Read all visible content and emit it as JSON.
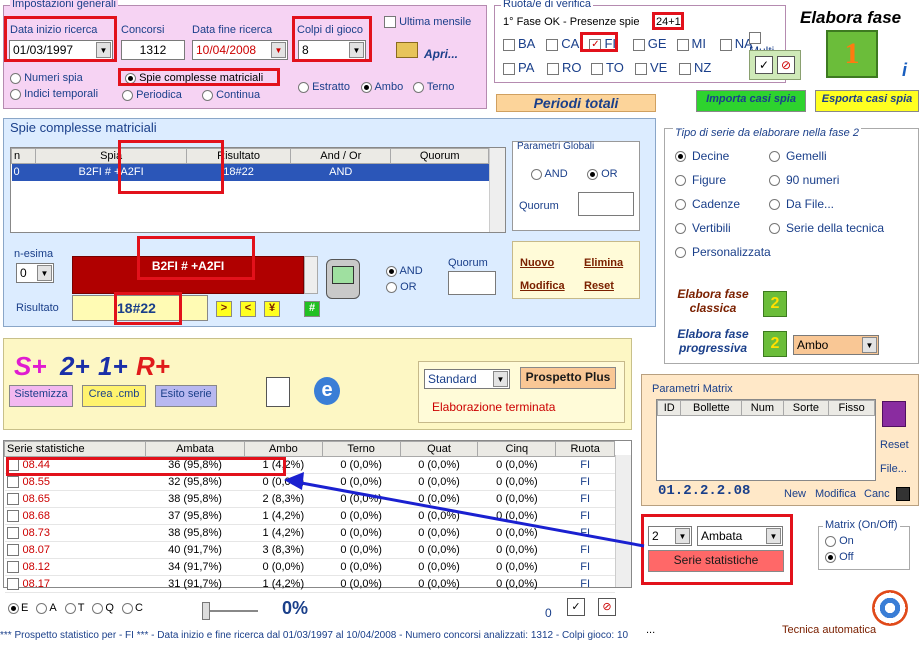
{
  "impostazioni": {
    "title": "Impostazioni generali",
    "data_inizio_label": "Data inizio ricerca",
    "data_inizio_value": "01/03/1997",
    "concorsi_label": "Concorsi",
    "concorsi_value": "1312",
    "data_fine_label": "Data fine ricerca",
    "data_fine_value": "10/04/2008",
    "colpi_label": "Colpi di gioco",
    "colpi_value": "8",
    "ultima_mensile": "Ultima mensile",
    "apri": "Apri...",
    "radio_numeri_spia": "Numeri spia",
    "radio_indici_temporali": "Indici temporali",
    "radio_spie_complesse": "Spie complesse matriciali",
    "radio_periodica": "Periodica",
    "radio_continua": "Continua",
    "radio_estratto": "Estratto",
    "radio_ambo": "Ambo",
    "radio_terno": "Terno"
  },
  "ruota": {
    "title": "Ruota/e di verifica",
    "fase_label": "1° Fase OK - Presenze spie",
    "presenze": "24+1",
    "ruote_row1": [
      "BA",
      "CA",
      "FI",
      "GE",
      "MI",
      "NA"
    ],
    "ruote_row2": [
      "PA",
      "RO",
      "TO",
      "VE",
      "NZ"
    ],
    "multi": "Multi"
  },
  "elabora_fase": "Elabora fase",
  "fase_number": "1",
  "periodi_totali": "Periodi totali",
  "importa": "Importa casi spia",
  "esporta": "Esporta casi spia",
  "spie": {
    "title": "Spie complesse matriciali",
    "columns": [
      "n",
      "Spia",
      "Risultato",
      "And / Or",
      "Quorum"
    ],
    "rows": [
      [
        "0",
        "B2FI # +A2FI",
        "18#22",
        "AND",
        ""
      ]
    ],
    "parametri_globali": "Parametri Globali",
    "and": "AND",
    "or": "OR",
    "quorum": "Quorum",
    "n_esima": "n-esima",
    "n_esima_value": "0",
    "spia_edit": "B2FI # +A2FI",
    "risultato_label": "Risultato",
    "risultato_value": "18#22",
    "btn_gt": ">",
    "btn_lt": "<",
    "btn_yen": "¥",
    "btn_hash": "#",
    "and2": "AND",
    "or2": "OR",
    "quorum2": "Quorum",
    "nuovo": "Nuovo",
    "elimina": "Elimina",
    "modifica": "Modifica",
    "reset": "Reset"
  },
  "tipo_serie": {
    "title": "Tipo di serie da elaborare nella fase 2",
    "left": [
      "Decine",
      "Figure",
      "Cadenze",
      "Vertibili",
      "Personalizzata"
    ],
    "right": [
      "Gemelli",
      "90 numeri",
      "Da File...",
      "Serie della tecnica"
    ],
    "elabora_classica": "Elabora fase classica",
    "elabora_progressiva": "Elabora fase progressiva",
    "fase2_number": "2",
    "combo_value": "Ambo"
  },
  "sistema": {
    "logo_s": "S+",
    "logo_2": "2+",
    "logo_1": "1+",
    "logo_r": "R+",
    "sistemizza": "Sistemizza",
    "crea_cmb": "Crea .cmb",
    "esito_serie": "Esito serie",
    "standard": "Standard",
    "prospetto_plus": "Prospetto Plus",
    "elaborazione": "Elaborazione terminata"
  },
  "matrix": {
    "title": "Parametri Matrix",
    "columns": [
      "ID",
      "Bollette",
      "Num",
      "Sorte",
      "Fisso"
    ],
    "code": "01.2.2.2.08",
    "new": "New",
    "modifica": "Modifica",
    "canc": "Canc",
    "reset": "Reset",
    "file": "File...",
    "onoff_title": "Matrix (On/Off)",
    "on": "On",
    "off": "Off"
  },
  "statistiche": {
    "columns": [
      "Serie statistiche",
      "Ambata",
      "Ambo",
      "Terno",
      "Quat",
      "Cinq",
      "Ruota"
    ],
    "rows": [
      [
        "08.44",
        "36 (95,8%)",
        "1 (4,2%)",
        "0 (0,0%)",
        "0 (0,0%)",
        "0 (0,0%)",
        "FI"
      ],
      [
        "08.55",
        "32 (95,8%)",
        "0 (0,0%)",
        "0 (0,0%)",
        "0 (0,0%)",
        "0 (0,0%)",
        "FI"
      ],
      [
        "08.65",
        "38 (95,8%)",
        "2 (8,3%)",
        "0 (0,0%)",
        "0 (0,0%)",
        "0 (0,0%)",
        "FI"
      ],
      [
        "08.68",
        "37 (95,8%)",
        "1 (4,2%)",
        "0 (0,0%)",
        "0 (0,0%)",
        "0 (0,0%)",
        "FI"
      ],
      [
        "08.73",
        "38 (95,8%)",
        "1 (4,2%)",
        "0 (0,0%)",
        "0 (0,0%)",
        "0 (0,0%)",
        "FI"
      ],
      [
        "08.07",
        "40 (91,7%)",
        "3 (8,3%)",
        "0 (0,0%)",
        "0 (0,0%)",
        "0 (0,0%)",
        "FI"
      ],
      [
        "08.12",
        "34 (91,7%)",
        "0 (0,0%)",
        "0 (0,0%)",
        "0 (0,0%)",
        "0 (0,0%)",
        "FI"
      ],
      [
        "08.17",
        "31 (91,7%)",
        "1 (4,2%)",
        "0 (0,0%)",
        "0 (0,0%)",
        "0 (0,0%)",
        "FI"
      ]
    ],
    "combo_num": "2",
    "combo_sorte": "Ambata",
    "btn": "Serie statistiche"
  },
  "bottom": {
    "radios": [
      "E",
      "A",
      "T",
      "Q",
      "C"
    ],
    "percent": "0%",
    "count": "0",
    "ellipsis": "...",
    "tecnica": "Tecnica automatica",
    "status": "*** Prospetto statistico per  - FI *** - Data inizio e fine ricerca dal 01/03/1997 al 10/04/2008 - Numero concorsi analizzati: 1312 - Colpi gioco: 10"
  }
}
